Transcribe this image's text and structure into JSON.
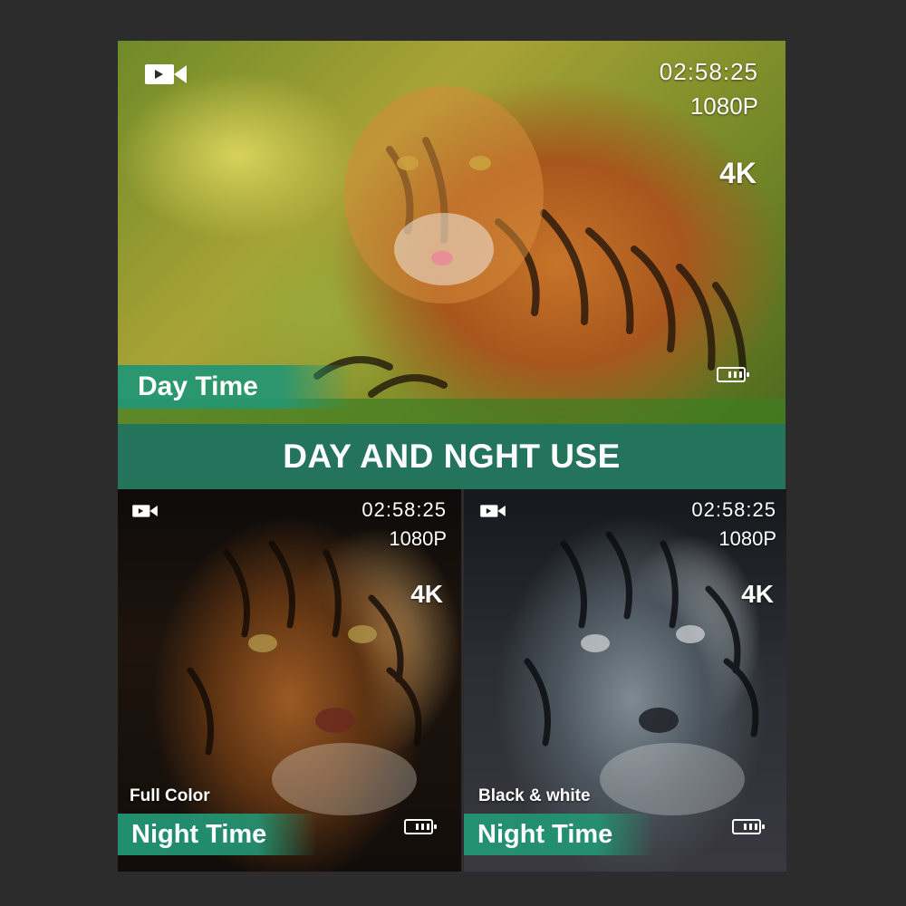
{
  "banner": {
    "title": "DAY AND NGHT USE"
  },
  "panels": {
    "day": {
      "icon": "video-camera-icon",
      "time": "02:58:25",
      "resolution": "1080P",
      "quality": "4K",
      "label": "Day Time",
      "battery_icon": "battery-icon"
    },
    "night_color": {
      "icon": "video-camera-icon",
      "time": "02:58:25",
      "resolution": "1080P",
      "quality": "4K",
      "mode": "Full Color",
      "label": "Night Time",
      "battery_icon": "battery-icon"
    },
    "night_bw": {
      "icon": "video-camera-icon",
      "time": "02:58:25",
      "resolution": "1080P",
      "quality": "4K",
      "mode": "Black & white",
      "label": "Night Time",
      "battery_icon": "battery-icon"
    }
  },
  "colors": {
    "background": "#2c2c2c",
    "banner": "#23745a",
    "label_bar": "#229674",
    "text": "#ffffff"
  }
}
